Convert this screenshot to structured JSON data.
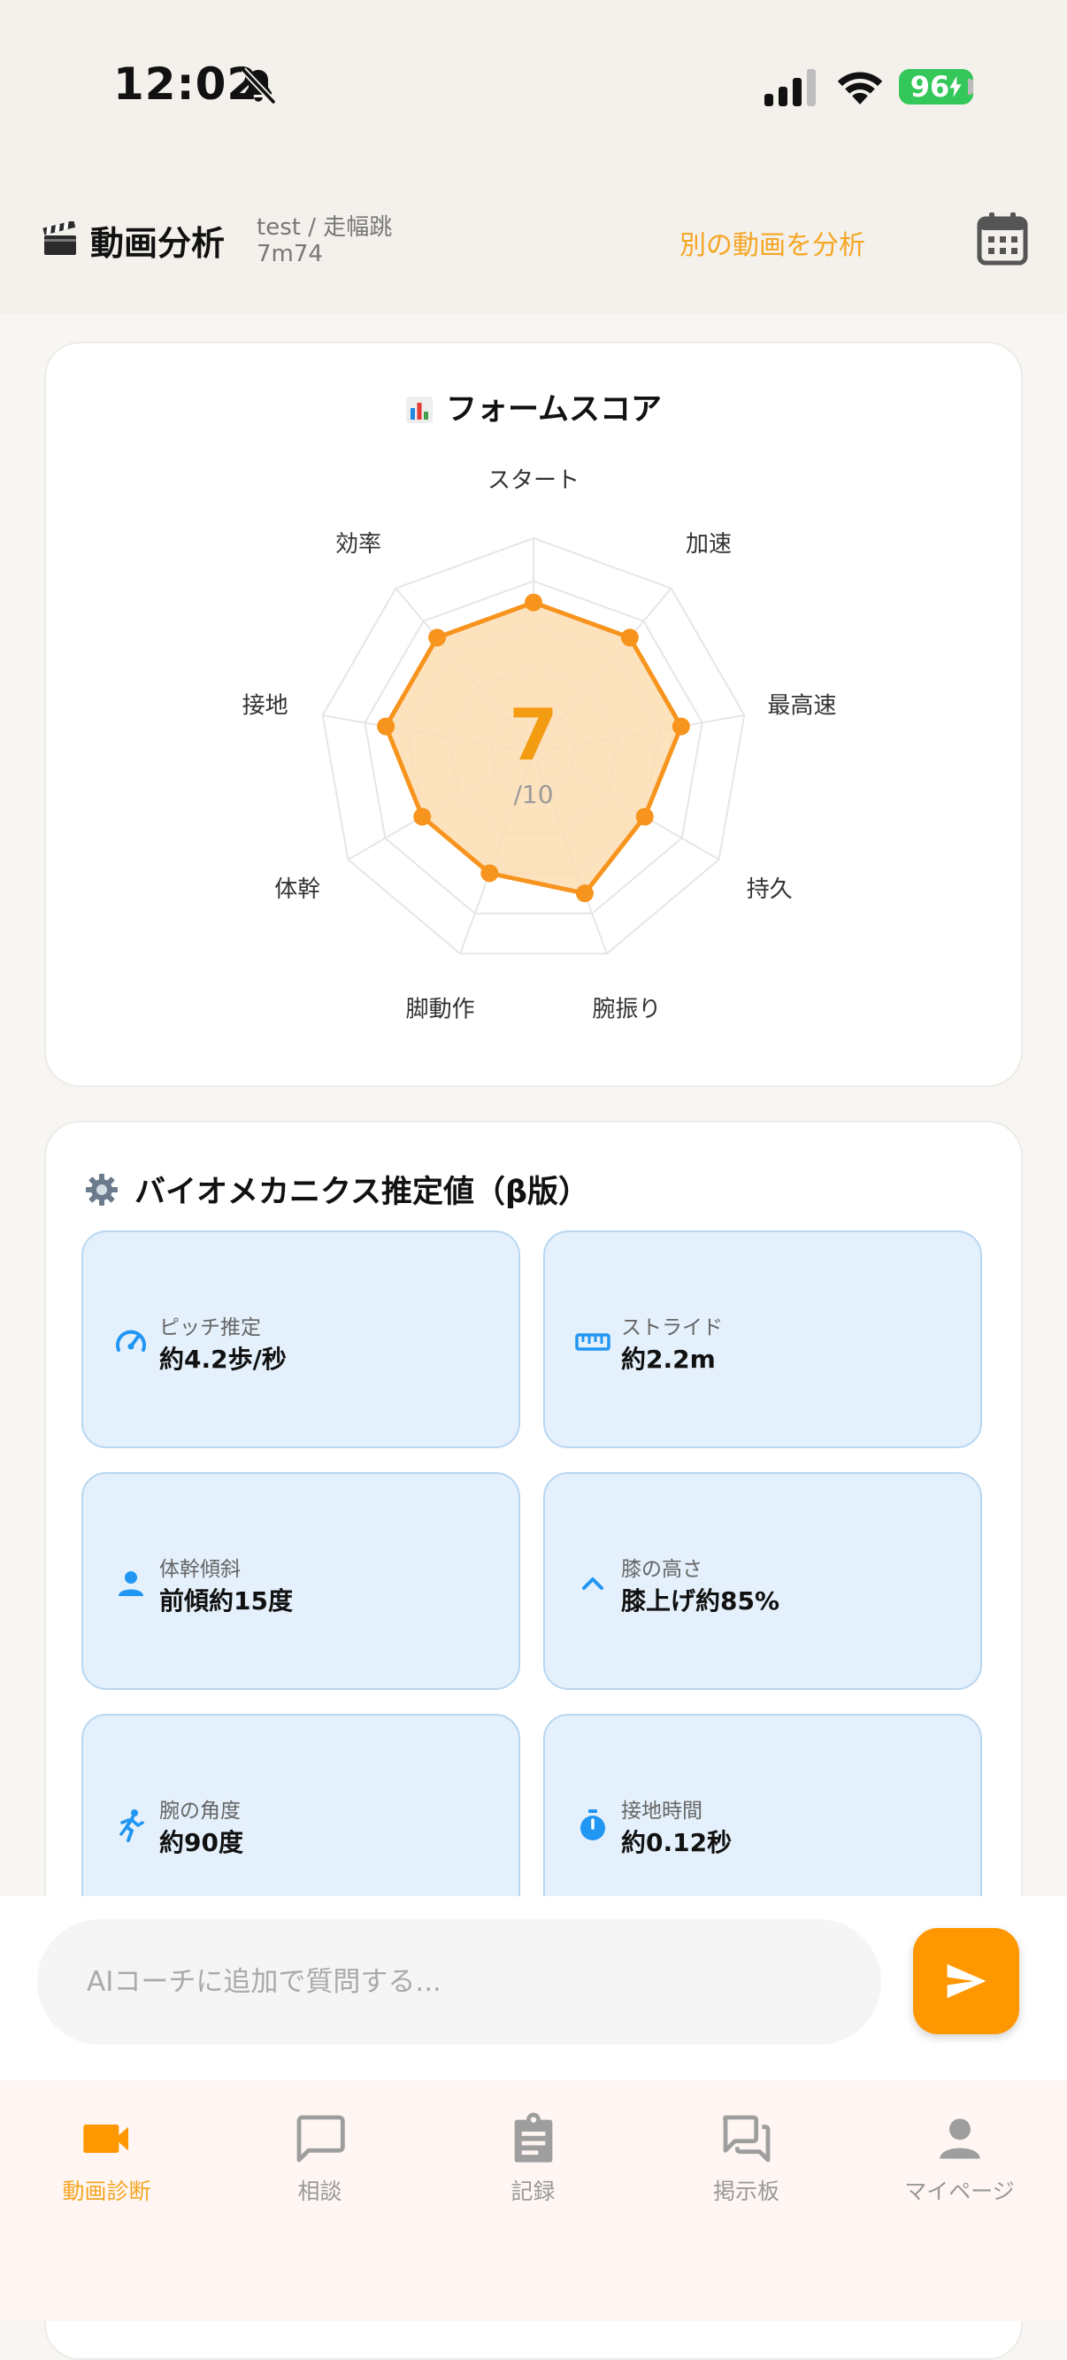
{
  "status_bar": {
    "time": "12:02",
    "battery": "96"
  },
  "header": {
    "title": "動画分析",
    "subtitle_line1": "test / 走幅跳",
    "subtitle_line2": "7m74",
    "analyze_other": "別の動画を分析"
  },
  "score_card": {
    "title": "フォームスコア",
    "score": "7",
    "score_max": "/10"
  },
  "chart_data": {
    "type": "radar",
    "title": "フォームスコア",
    "axes": [
      "スタート",
      "加速",
      "最高速",
      "持久",
      "腕振り",
      "脚動作",
      "体幹",
      "接地",
      "効率"
    ],
    "values": [
      7,
      7,
      7,
      6,
      7,
      6,
      6,
      7,
      7
    ],
    "range": [
      0,
      10
    ],
    "rings": 5,
    "color": "#F7941D",
    "fill": "#FDDDB3"
  },
  "bio_card": {
    "title": "バイオメカニクス推定値（β版）",
    "tiles": [
      {
        "label": "ピッチ推定",
        "value": "約4.2歩/秒",
        "icon": "speedometer-icon"
      },
      {
        "label": "ストライド",
        "value": "約2.2m",
        "icon": "ruler-icon"
      },
      {
        "label": "体幹傾斜",
        "value": "前傾約15度",
        "icon": "person-icon"
      },
      {
        "label": "膝の高さ",
        "value": "膝上げ約85%",
        "icon": "chevron-up-icon"
      },
      {
        "label": "腕の角度",
        "value": "約90度",
        "icon": "runner-icon"
      },
      {
        "label": "接地時間",
        "value": "約0.12秒",
        "icon": "stopwatch-icon"
      }
    ],
    "accent": "#2196F3"
  },
  "chat": {
    "placeholder": "AIコーチに追加で質問する..."
  },
  "nav": {
    "items": [
      {
        "label": "動画診断",
        "icon": "video-camera-icon",
        "active": true
      },
      {
        "label": "相談",
        "icon": "chat-bubble-icon",
        "active": false
      },
      {
        "label": "記録",
        "icon": "clipboard-icon",
        "active": false
      },
      {
        "label": "掲示板",
        "icon": "forum-icon",
        "active": false
      },
      {
        "label": "マイページ",
        "icon": "account-icon",
        "active": false
      }
    ],
    "active_color": "#FF9800",
    "inactive_color": "#9E9E9E"
  }
}
